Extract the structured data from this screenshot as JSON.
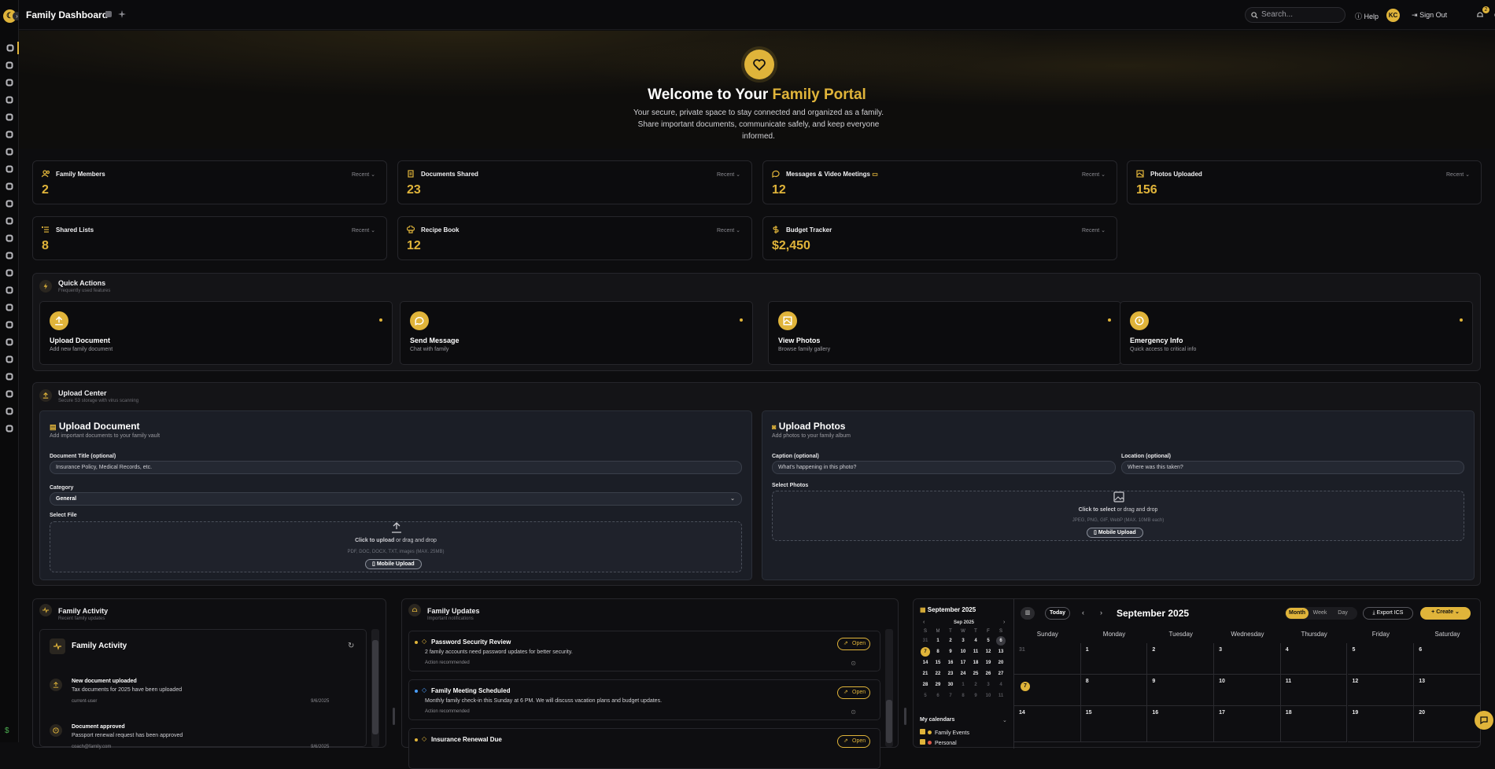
{
  "app": {
    "title": "Family Dashboard"
  },
  "topbar": {
    "search_placeholder": "Search...",
    "help": "Help",
    "avatar_initials": "KC",
    "sign_out": "Sign Out",
    "notification_count": "2"
  },
  "hero": {
    "title_prefix": "Welcome to Your ",
    "title_accent": "Family Portal",
    "subtitle": "Your secure, private space to stay connected and organized as a family. Share important documents, communicate safely, and keep everyone informed."
  },
  "stats": [
    {
      "label": "Family Members",
      "value": "2",
      "filter": "Recent",
      "icon": "users-icon"
    },
    {
      "label": "Documents Shared",
      "value": "23",
      "filter": "Recent",
      "icon": "document-icon"
    },
    {
      "label": "Messages & Video Meetings",
      "value": "12",
      "filter": "Recent",
      "icon": "chat-icon"
    },
    {
      "label": "Photos Uploaded",
      "value": "156",
      "filter": "Recent",
      "icon": "image-icon"
    },
    {
      "label": "Shared Lists",
      "value": "8",
      "filter": "Recent",
      "icon": "list-icon"
    },
    {
      "label": "Recipe Book",
      "value": "12",
      "filter": "Recent",
      "icon": "chef-hat-icon"
    },
    {
      "label": "Budget Tracker",
      "value": "$2,450",
      "filter": "Recent",
      "icon": "dollar-icon"
    }
  ],
  "quick_actions": {
    "title": "Quick Actions",
    "subtitle": "Frequently used features",
    "items": [
      {
        "title": "Upload Document",
        "subtitle": "Add new family document",
        "icon": "upload-icon"
      },
      {
        "title": "Send Message",
        "subtitle": "Chat with family",
        "icon": "chat-icon"
      },
      {
        "title": "View Photos",
        "subtitle": "Browse family gallery",
        "icon": "image-icon"
      },
      {
        "title": "Emergency Info",
        "subtitle": "Quick access to critical info",
        "icon": "alert-icon"
      }
    ]
  },
  "upload_center": {
    "title": "Upload Center",
    "subtitle": "Secure S3 storage with virus scanning",
    "document": {
      "title": "Upload Document",
      "subtitle": "Add important documents to your family vault",
      "doc_title_label": "Document Title (optional)",
      "doc_title_placeholder": "Insurance Policy, Medical Records, etc.",
      "category_label": "Category",
      "category_value": "General",
      "file_label": "Select File",
      "drop_click": "Click to upload",
      "drop_rest": " or drag and drop",
      "drop_hint": "PDF, DOC, DOCX, TXT, images (MAX. 25MB)",
      "mobile_upload": "Mobile Upload"
    },
    "photos": {
      "title": "Upload Photos",
      "subtitle": "Add photos to your family album",
      "caption_label": "Caption (optional)",
      "caption_placeholder": "What's happening in this photo?",
      "location_label": "Location (optional)",
      "location_placeholder": "Where was this taken?",
      "select_label": "Select Photos",
      "drop_click": "Click to select",
      "drop_rest": " or drag and drop",
      "drop_hint": "JPEG, PNG, GIF, WebP (MAX. 10MB each)",
      "mobile_upload": "Mobile Upload"
    }
  },
  "family_activity": {
    "title": "Family Activity",
    "subtitle": "Recent family updates",
    "inner_title": "Family Activity",
    "items": [
      {
        "title": "New document uploaded",
        "desc": "Tax documents for 2025 have been uploaded",
        "user": "current-user",
        "date": "9/6/2025"
      },
      {
        "title": "Document approved",
        "desc": "Passport renewal request has been approved",
        "user": "coach@family.com",
        "date": "9/6/2025"
      }
    ]
  },
  "family_updates": {
    "title": "Family Updates",
    "subtitle": "Important notifications",
    "open_label": "Open",
    "items": [
      {
        "title": "Password Security Review",
        "desc": "2 family accounts need password updates for better security.",
        "note": "Action recommended",
        "color": "#e0b43a"
      },
      {
        "title": "Family Meeting Scheduled",
        "desc": "Monthly family check-in this Sunday at 6 PM. We will discuss vacation plans and budget updates.",
        "note": "Action recommended",
        "color": "#4a9eff"
      },
      {
        "title": "Insurance Renewal Due",
        "desc": "",
        "note": "",
        "color": "#e0b43a"
      }
    ]
  },
  "calendar": {
    "sidebar_title": "September 2025",
    "mini_month": "Sep 2025",
    "weekday_initials": [
      "S",
      "M",
      "T",
      "W",
      "T",
      "F",
      "S"
    ],
    "my_calendars_label": "My calendars",
    "calendars": [
      {
        "name": "Family Events",
        "color": "#e0b43a"
      },
      {
        "name": "Personal",
        "color": "#e05a4a"
      }
    ],
    "today_label": "Today",
    "month_title": "September 2025",
    "views": [
      "Month",
      "Week",
      "Day"
    ],
    "active_view": "Month",
    "export_label": "Export ICS",
    "create_label": "Create",
    "day_headers": [
      "Sunday",
      "Monday",
      "Tuesday",
      "Wednesday",
      "Thursday",
      "Friday",
      "Saturday"
    ],
    "today_date": "7"
  }
}
